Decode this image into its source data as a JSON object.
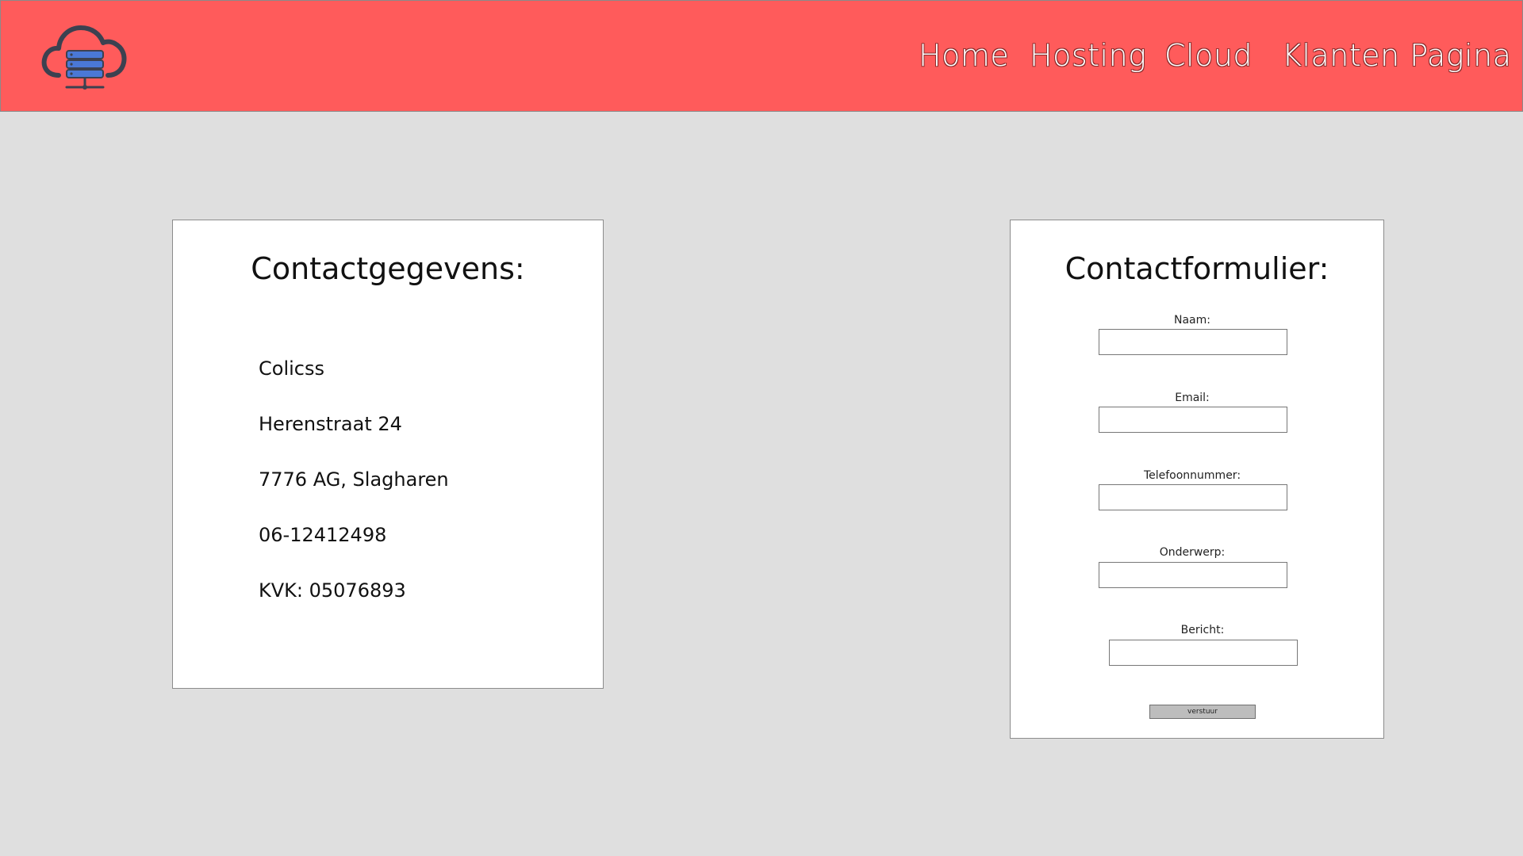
{
  "nav": {
    "logo_icon": "cloud-server-icon",
    "items": [
      {
        "label": "Home"
      },
      {
        "label": "Hosting"
      },
      {
        "label": "Cloud"
      },
      {
        "label": "Klanten Pagina"
      }
    ]
  },
  "contact_info": {
    "title": "Contactgegevens:",
    "lines": [
      "Colicss",
      "Herenstraat 24",
      "7776 AG, Slagharen",
      "06-12412498",
      "KVK: 05076893"
    ]
  },
  "contact_form": {
    "title": "Contactformulier:",
    "fields": [
      {
        "label": "Naam:",
        "value": "",
        "placeholder": ""
      },
      {
        "label": "Email:",
        "value": "",
        "placeholder": ""
      },
      {
        "label": "Telefoonnummer:",
        "value": "",
        "placeholder": ""
      },
      {
        "label": "Onderwerp:",
        "value": "",
        "placeholder": ""
      },
      {
        "label": "Bericht:",
        "value": "",
        "placeholder": ""
      }
    ],
    "submit_label": "verstuur"
  },
  "colors": {
    "header": "#ff5b5b",
    "page_background": "#dfdfdf",
    "card_background": "#ffffff",
    "logo_dark": "#3c4150",
    "logo_blue": "#4a78d6"
  }
}
